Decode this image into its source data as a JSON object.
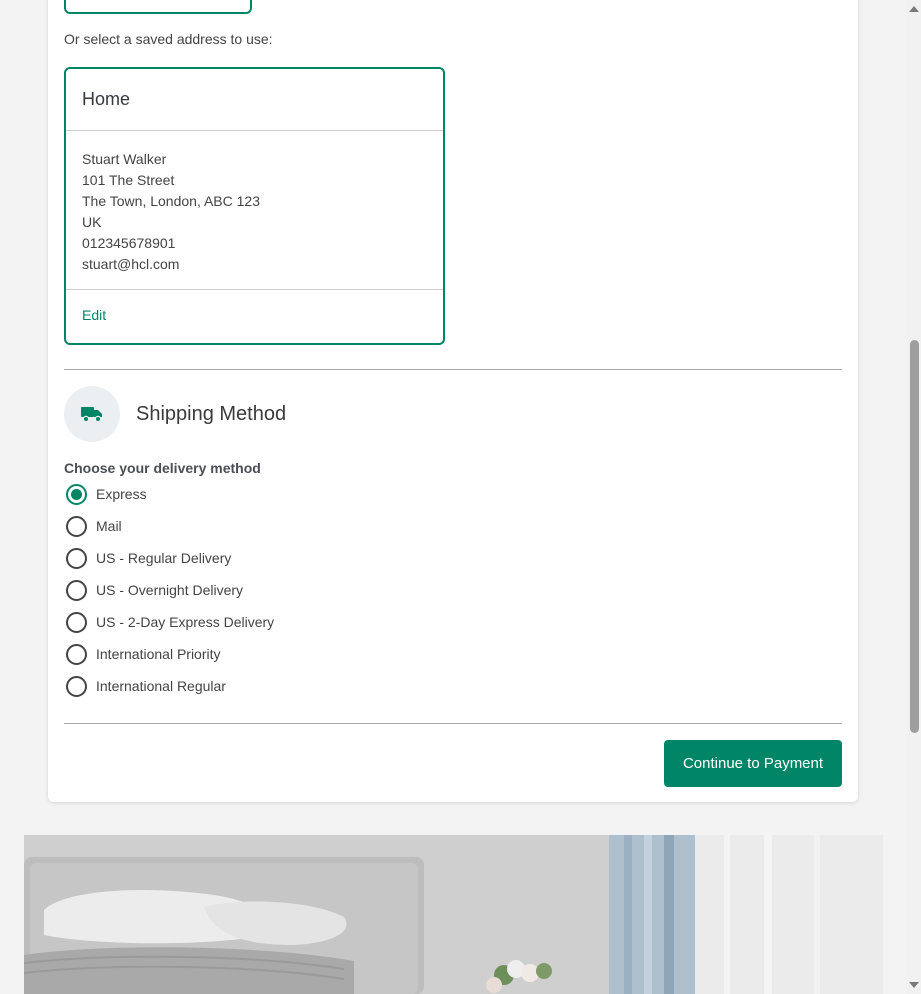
{
  "saved_address_prompt": "Or select a saved address to use:",
  "address": {
    "title": "Home",
    "lines": [
      "Stuart Walker",
      "101 The Street",
      "The Town, London, ABC 123",
      "UK",
      "012345678901",
      "stuart@hcl.com"
    ],
    "edit_label": "Edit"
  },
  "shipping": {
    "title": "Shipping Method",
    "icon": "truck-icon",
    "choose_label": "Choose your delivery method",
    "options": [
      {
        "label": "Express",
        "selected": true
      },
      {
        "label": "Mail",
        "selected": false
      },
      {
        "label": "US - Regular Delivery",
        "selected": false
      },
      {
        "label": "US - Overnight Delivery",
        "selected": false
      },
      {
        "label": "US - 2-Day Express Delivery",
        "selected": false
      },
      {
        "label": "International Priority",
        "selected": false
      },
      {
        "label": "International Regular",
        "selected": false
      }
    ]
  },
  "continue_label": "Continue to Payment",
  "colors": {
    "accent": "#008667",
    "background": "#f3f3f3"
  }
}
